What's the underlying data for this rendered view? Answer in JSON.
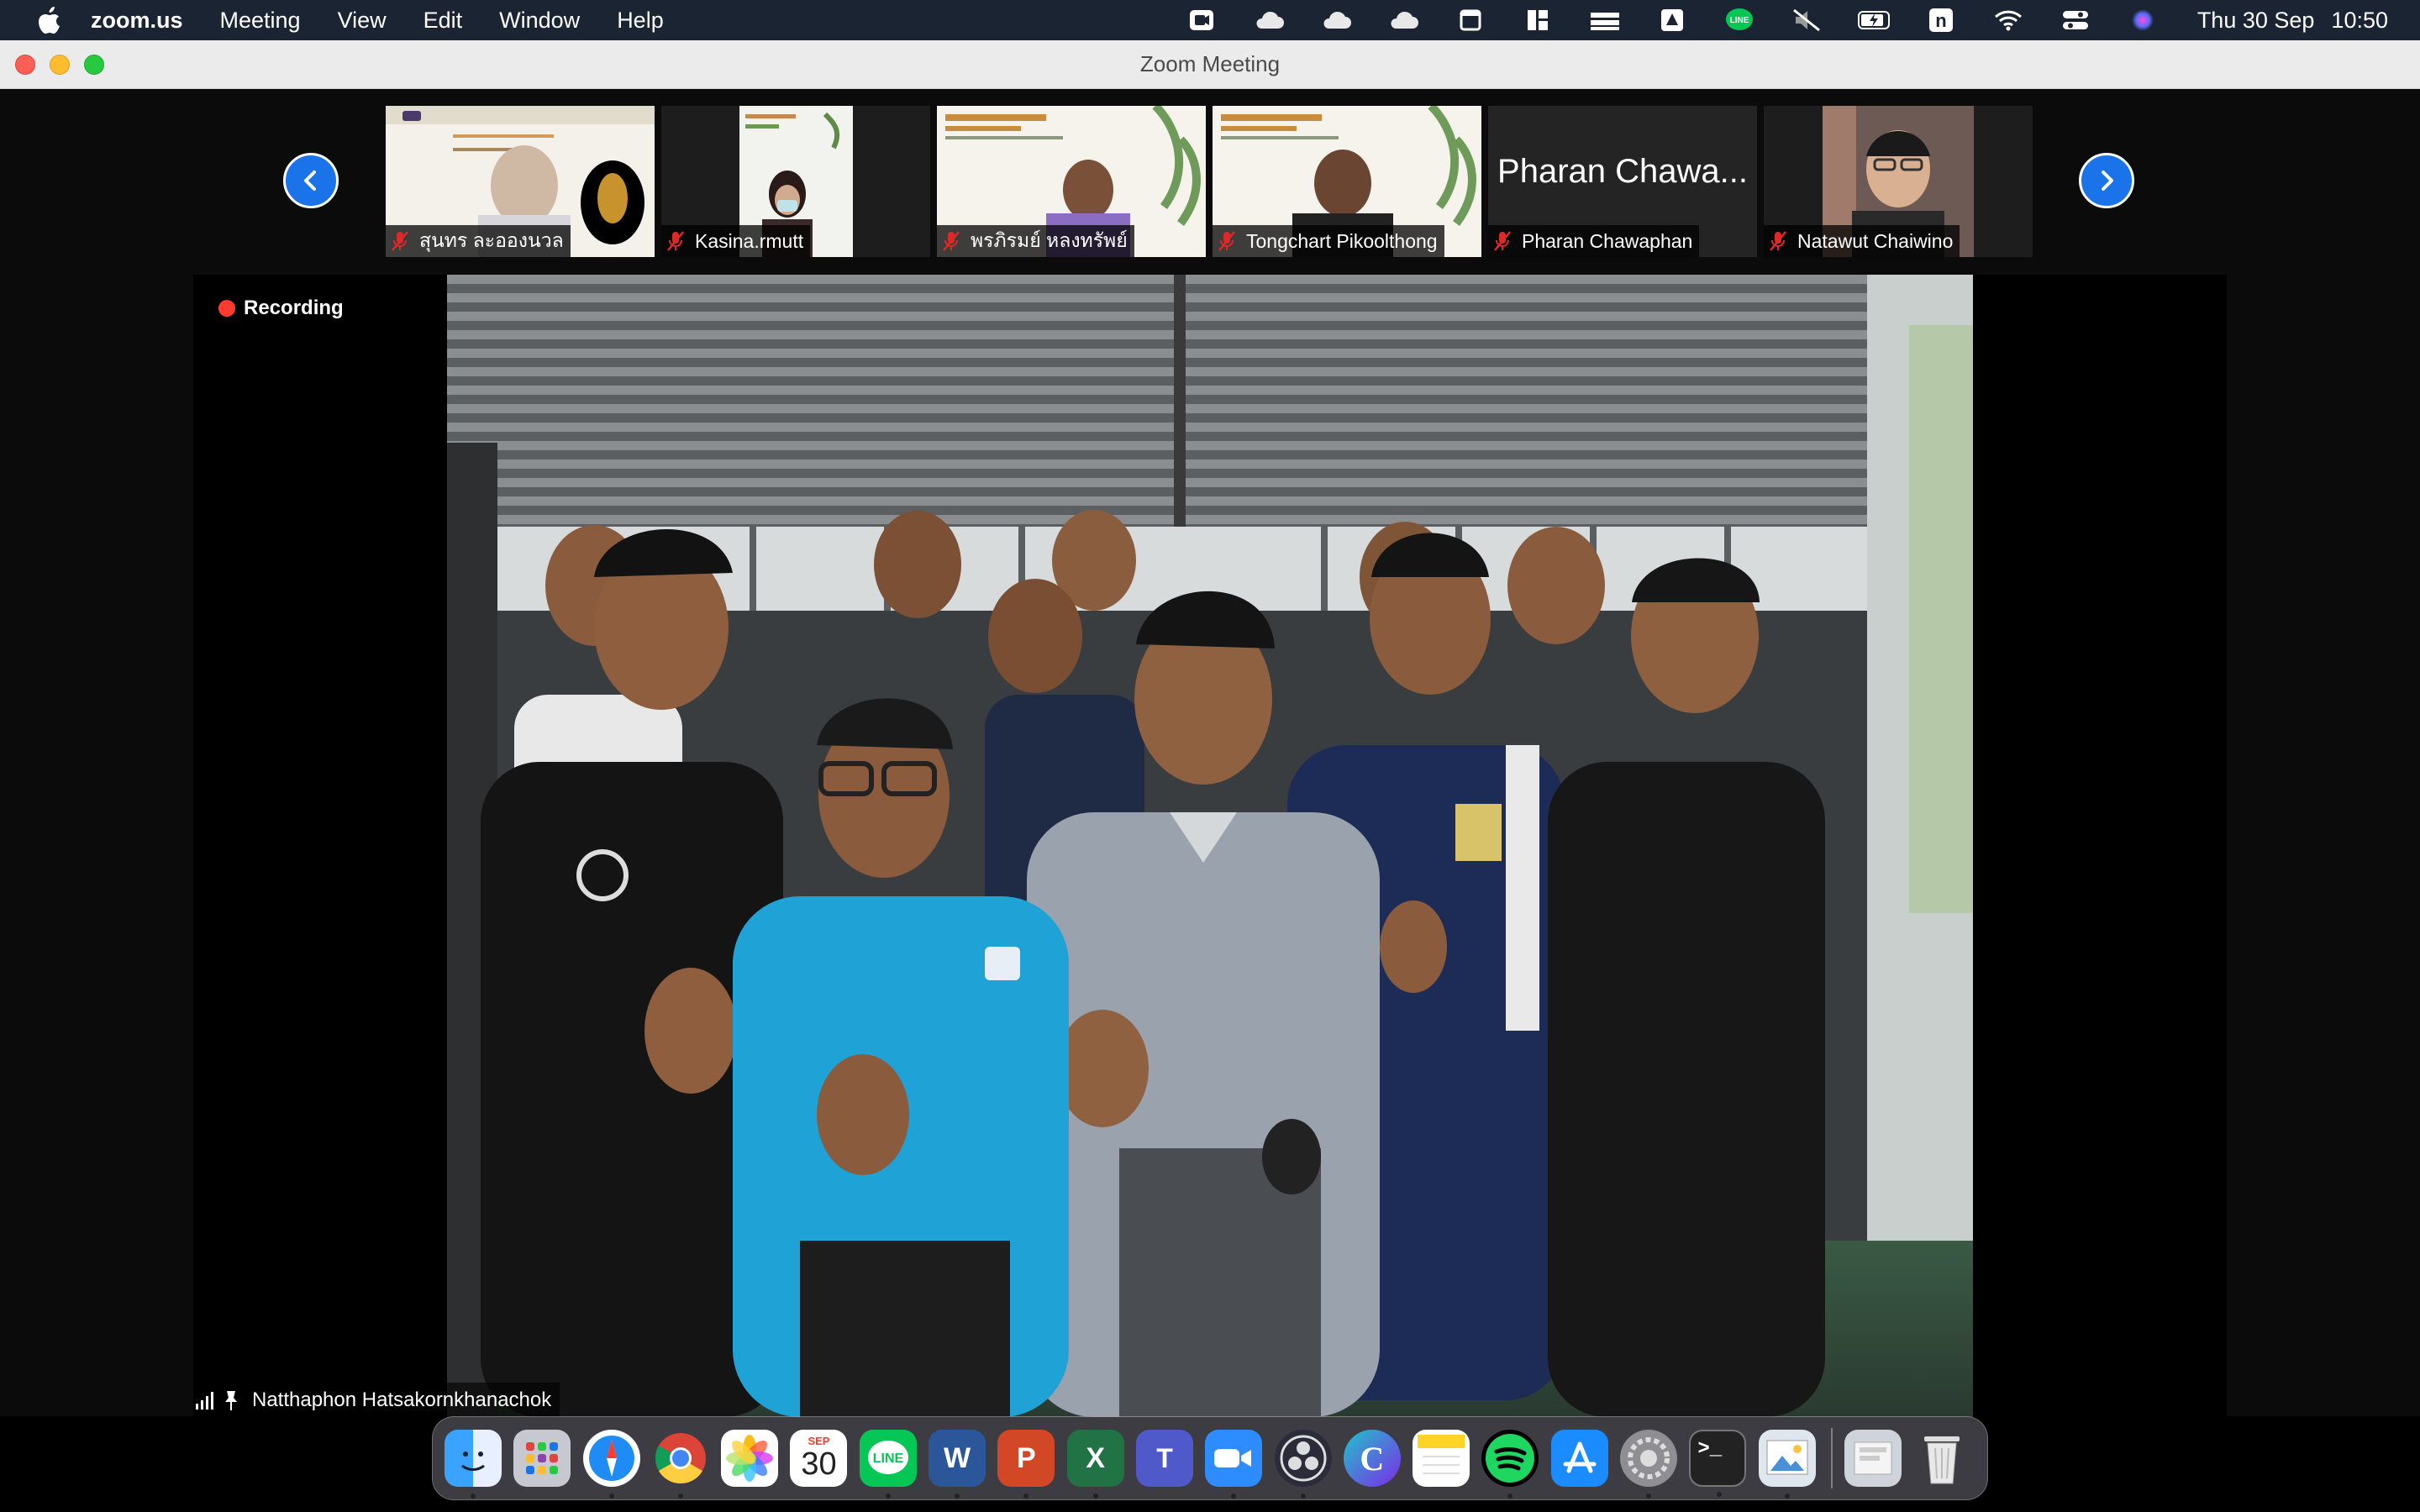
{
  "menubar": {
    "app": "zoom.us",
    "items": [
      "Meeting",
      "View",
      "Edit",
      "Window",
      "Help"
    ],
    "date": "Thu 30 Sep",
    "time": "10:50",
    "status_icons": [
      "camera-icon",
      "cloud-icon",
      "cloud-icon",
      "cloud-icon",
      "window-icon",
      "grid-icon",
      "stack-icon",
      "drive-icon",
      "line-icon",
      "mute-icon",
      "battery-icon",
      "n-icon",
      "wifi-icon",
      "control-center-icon",
      "siri-icon"
    ]
  },
  "window": {
    "title": "Zoom Meeting"
  },
  "participants": [
    {
      "name": "สุนทร ละอองนวล",
      "muted": true
    },
    {
      "name": "Kasina.rmutt",
      "muted": true
    },
    {
      "name": "พรภิรมย์ หลงทรัพย์",
      "muted": true
    },
    {
      "name": "Tongchart Pikoolthong",
      "muted": true
    },
    {
      "name": "Pharan Chawaphan",
      "display": "Pharan Chawa...",
      "muted": true
    },
    {
      "name": "Natawut Chaiwino",
      "muted": true
    }
  ],
  "main": {
    "recording": "Recording",
    "speaker": "Natthaphon Hatsakornkhanachok"
  },
  "dock": {
    "apps": [
      "Finder",
      "Launchpad",
      "Safari",
      "Chrome",
      "Photos",
      "Calendar",
      "LINE",
      "Word",
      "PowerPoint",
      "Excel",
      "Teams",
      "Zoom",
      "OBS",
      "Canva",
      "Notes",
      "Spotify",
      "App Store",
      "System Preferences",
      "Terminal",
      "Preview",
      "Downloads",
      "Trash"
    ],
    "calendar_month": "SEP",
    "calendar_day": "30"
  },
  "colors": {
    "menubar": "#1b2432",
    "accent": "#1a73e8",
    "recording": "#ff3b30"
  }
}
